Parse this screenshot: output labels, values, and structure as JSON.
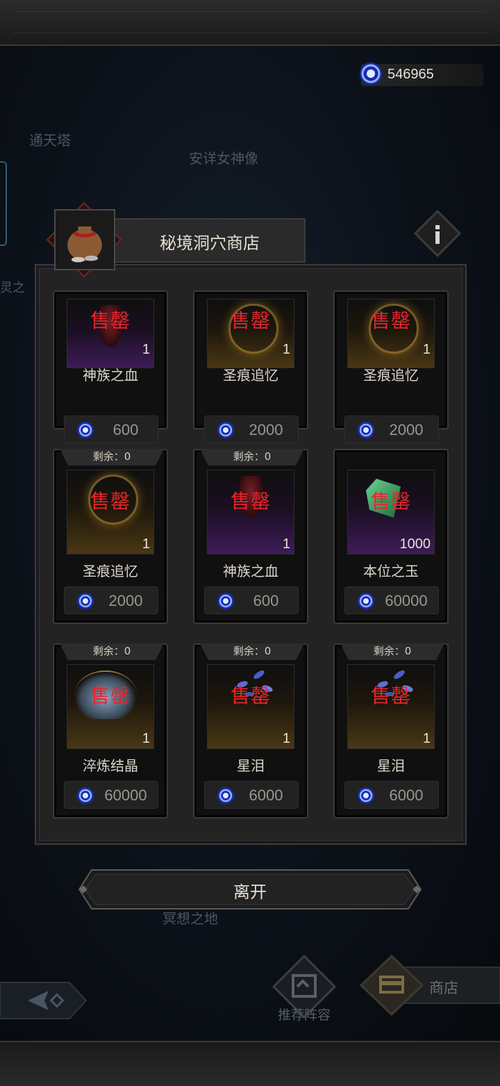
{
  "currency": {
    "amount": "546965",
    "icon": "blue-portal-coin-icon"
  },
  "background_labels": {
    "tower": "通天塔",
    "statue": "安详女神像",
    "meditation": "冥想之地",
    "left_partial": "灵之"
  },
  "shop": {
    "title": "秘境洞穴商店",
    "sold_out_label": "售罄",
    "remaining_prefix": "剩余：",
    "items": [
      {
        "name": "神族之血",
        "qty": "1",
        "price": "600",
        "remaining": "",
        "art": "purple"
      },
      {
        "name": "圣痕追忆",
        "qty": "1",
        "price": "2000",
        "remaining": "",
        "art": "gold"
      },
      {
        "name": "圣痕追忆",
        "qty": "1",
        "price": "2000",
        "remaining": "",
        "art": "gold"
      },
      {
        "name": "圣痕追忆",
        "qty": "1",
        "price": "2000",
        "remaining": "剩余：0",
        "art": "gold"
      },
      {
        "name": "神族之血",
        "qty": "1",
        "price": "600",
        "remaining": "剩余：0",
        "art": "purple"
      },
      {
        "name": "本位之玉",
        "qty": "1000",
        "price": "60000",
        "remaining": "",
        "art": "purple"
      },
      {
        "name": "淬炼结晶",
        "qty": "1",
        "price": "60000",
        "remaining": "剩余：0",
        "art": "gold"
      },
      {
        "name": "星泪",
        "qty": "1",
        "price": "6000",
        "remaining": "剩余：0",
        "art": "gold"
      },
      {
        "name": "星泪",
        "qty": "1",
        "price": "6000",
        "remaining": "剩余：0",
        "art": "gold"
      }
    ]
  },
  "leave_button": "离开",
  "bottom_nav": {
    "recommend": "推荐阵容",
    "shop": "商店"
  },
  "colors": {
    "sold_out": "#e6262b",
    "panel_bg": "#232323",
    "coin_blue": "#3b6fff"
  }
}
